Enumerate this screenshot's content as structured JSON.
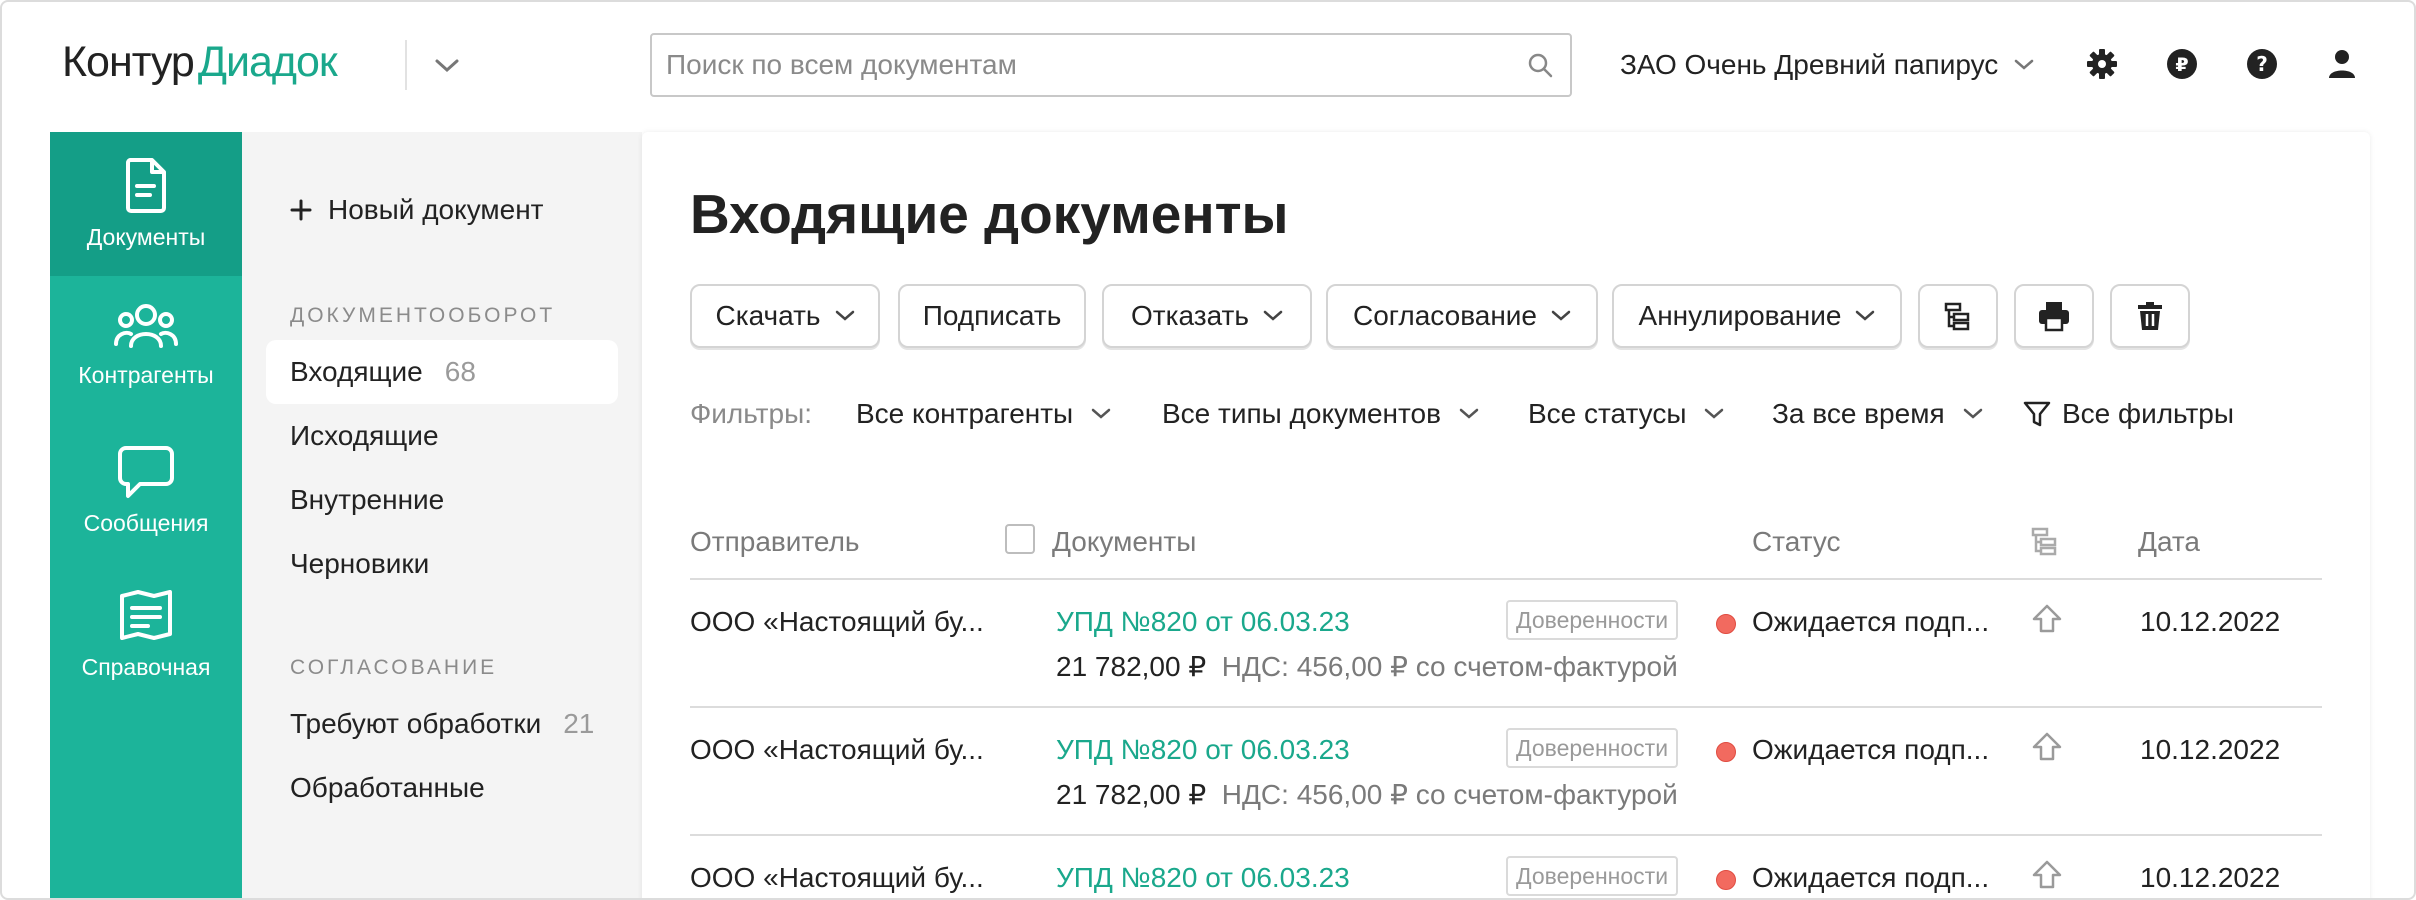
{
  "header": {
    "logo_part1": "Контур",
    "logo_part2": "Диадок",
    "search_placeholder": "Поиск по всем документам",
    "organization": "ЗАО Очень Древний папирус"
  },
  "rail": [
    {
      "label": "Документы",
      "icon": "document-icon"
    },
    {
      "label": "Контрагенты",
      "icon": "people-icon"
    },
    {
      "label": "Сообщения",
      "icon": "message-icon"
    },
    {
      "label": "Справочная",
      "icon": "book-icon"
    }
  ],
  "subnav": {
    "new_document": "Новый документ",
    "section1_title": "ДОКУМЕНТООБОРОТ",
    "section1_items": [
      {
        "label": "Входящие",
        "count": "68"
      },
      {
        "label": "Исходящие",
        "count": ""
      },
      {
        "label": "Внутренние",
        "count": ""
      },
      {
        "label": "Черновики",
        "count": ""
      }
    ],
    "section2_title": "СОГЛАСОВАНИЕ",
    "section2_items": [
      {
        "label": "Требуют обработки",
        "count": "21"
      },
      {
        "label": "Обработанные",
        "count": ""
      }
    ]
  },
  "main": {
    "title": "Входящие документы",
    "toolbar": {
      "download": "Скачать",
      "sign": "Подписать",
      "reject": "Отказать",
      "approval": "Согласование",
      "annul": "Аннулирование"
    },
    "filters": {
      "label": "Фильтры:",
      "contractors": "Все контрагенты",
      "doc_types": "Все типы документов",
      "statuses": "Все статусы",
      "period": "За все время",
      "all_filters": "Все фильтры"
    },
    "columns": {
      "sender": "Отправитель",
      "documents": "Документы",
      "status": "Статус",
      "date": "Дата"
    },
    "rows": [
      {
        "sender": "ООО «Настоящий бу...",
        "doc": "УПД №820 от 06.03.23",
        "tag": "Доверенности",
        "amount": "21 782,00 ₽",
        "nds": "НДС: 456,00 ₽ со счетом-фактурой",
        "status": "Ожидается подп...",
        "date": "10.12.2022"
      },
      {
        "sender": "ООО «Настоящий бу...",
        "doc": "УПД №820 от 06.03.23",
        "tag": "Доверенности",
        "amount": "21 782,00 ₽",
        "nds": "НДС: 456,00 ₽ со счетом-фактурой",
        "status": "Ожидается подп...",
        "date": "10.12.2022"
      },
      {
        "sender": "ООО «Настоящий бу...",
        "doc": "УПД №820 от 06.03.23",
        "tag": "Доверенности",
        "amount": "",
        "nds": "",
        "status": "Ожидается подп...",
        "date": "10.12.2022"
      }
    ]
  },
  "colors": {
    "accent": "#1cb49a",
    "accent_dark": "#149e87",
    "link": "#1aa88c",
    "status_dot": "#f26a5f"
  }
}
